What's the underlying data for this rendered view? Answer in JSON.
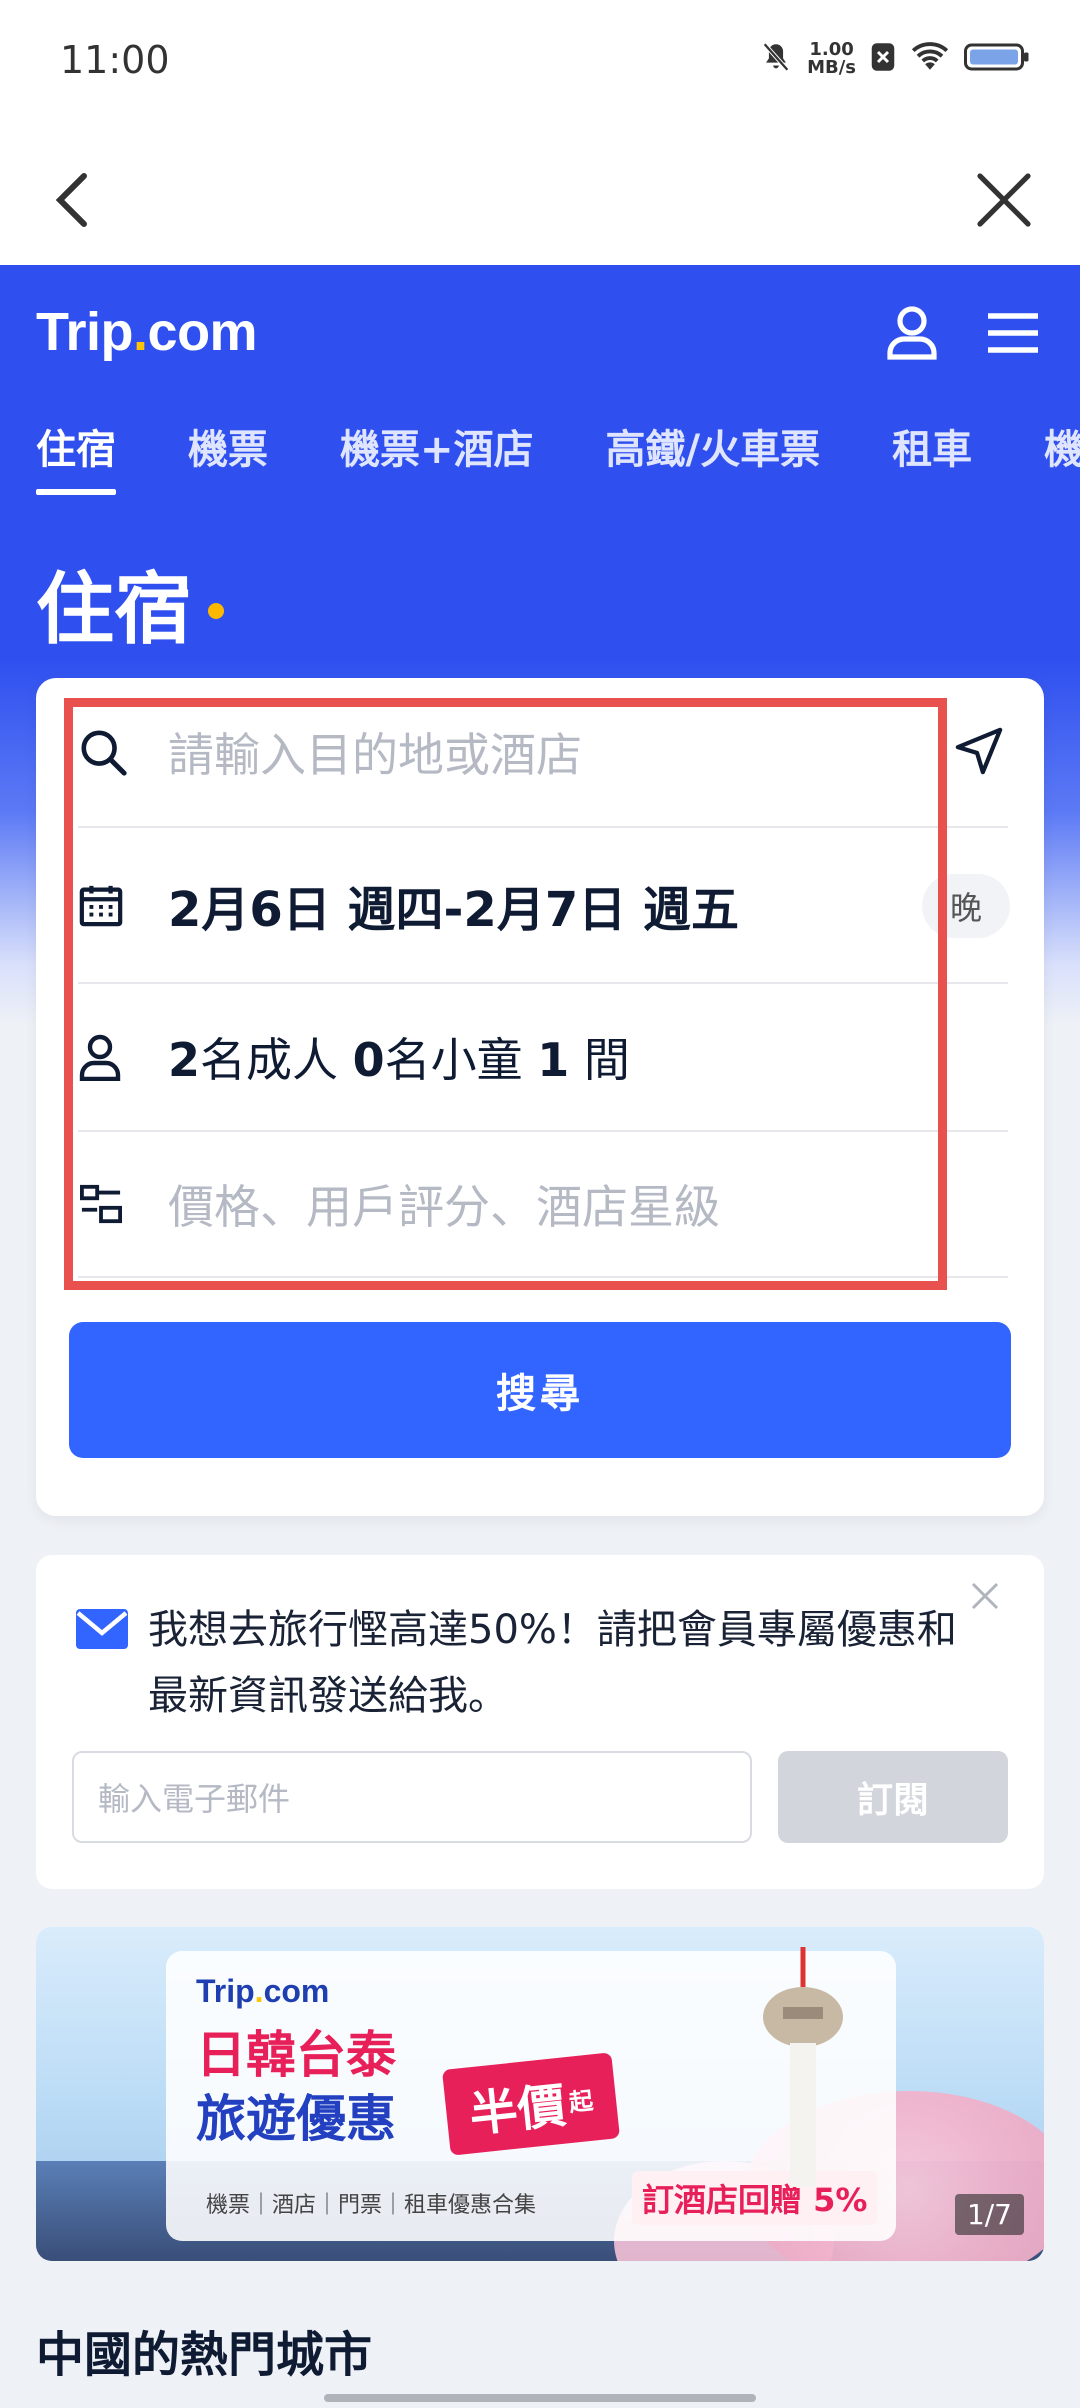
{
  "status_bar": {
    "time": "11:00",
    "net_speed_value": "1.00",
    "net_speed_unit": "MB/s"
  },
  "header": {
    "logo_main": "Trip",
    "logo_dot": ".",
    "logo_tail": "com"
  },
  "tabs": [
    {
      "label": "住宿",
      "active": true
    },
    {
      "label": "機票"
    },
    {
      "label": "機票+酒店"
    },
    {
      "label": "高鐵/火車票"
    },
    {
      "label": "租車"
    },
    {
      "label": "機"
    }
  ],
  "hero_title": "住宿",
  "search_card": {
    "destination_placeholder": "請輸入目的地或酒店",
    "dates": "2月6日 週四-2月7日 週五",
    "nights_label": "晚",
    "guests": {
      "adults_count": "2",
      "adults_label": "名成人",
      "children_count": "0",
      "children_label": "名小童",
      "rooms_count": "1",
      "rooms_label": "間"
    },
    "filter_placeholder": "價格、用戶評分、酒店星級",
    "search_button": "搜尋"
  },
  "subscribe": {
    "message": "我想去旅行慳高達50%！請把會員專屬優惠和最新資訊發送給我。",
    "email_placeholder": "輸入電子郵件",
    "button": "訂閱"
  },
  "banner": {
    "logo_main": "Trip",
    "logo_dot": ".",
    "logo_tail": "com",
    "title_line1": "日韓台泰",
    "title_line2": "旅遊優惠",
    "badge": "半價",
    "badge_suffix": "起",
    "categories": "機票｜酒店｜門票｜租車優惠合集",
    "rebate": "訂酒店回贈 5%",
    "counter": "1/7"
  },
  "section_title": "中國的熱門城市",
  "colors": {
    "brand_blue": "#2f50ef",
    "button_blue": "#3264ff",
    "highlight_red": "#e8514d",
    "accent_yellow": "#ffc400"
  }
}
